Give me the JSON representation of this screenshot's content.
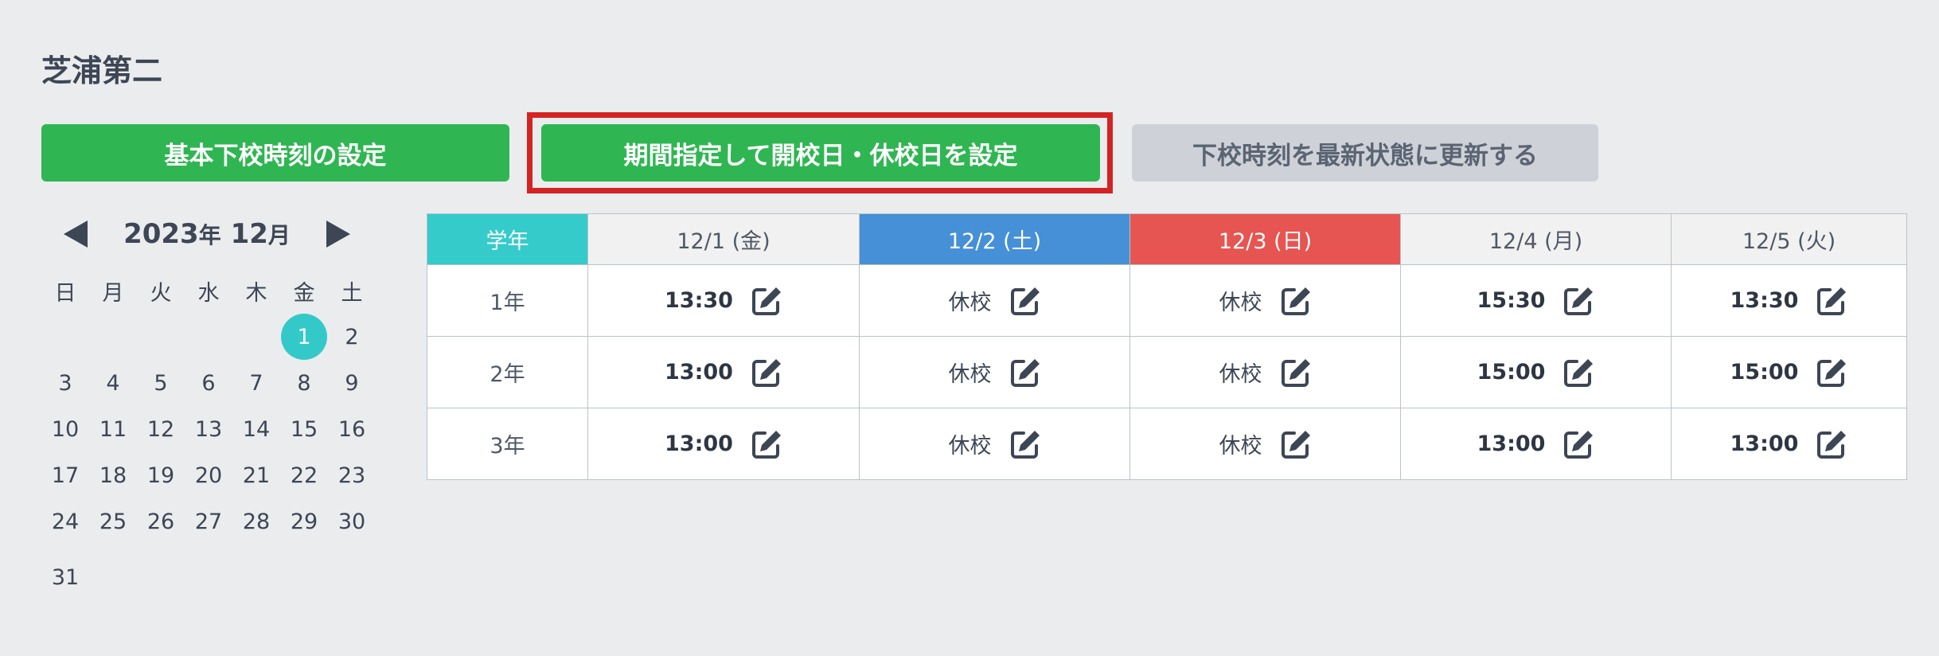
{
  "school_name": "芝浦第二",
  "buttons": {
    "basic": "基本下校時刻の設定",
    "period": "期間指定して開校日・休校日を設定",
    "refresh": "下校時刻を最新状態に更新する"
  },
  "colors": {
    "green": "#2fb652",
    "teal": "#36cbcb",
    "saturday": "#4590d6",
    "sunday": "#e65551",
    "highlight": "#d32423"
  },
  "calendar": {
    "year": "2023",
    "year_suffix": "年",
    "month": "12",
    "month_suffix": "月",
    "weekdays": [
      "日",
      "月",
      "火",
      "水",
      "木",
      "金",
      "土"
    ],
    "weeks": [
      [
        "",
        "",
        "",
        "",
        "",
        "1",
        "2"
      ],
      [
        "3",
        "4",
        "5",
        "6",
        "7",
        "8",
        "9"
      ],
      [
        "10",
        "11",
        "12",
        "13",
        "14",
        "15",
        "16"
      ],
      [
        "17",
        "18",
        "19",
        "20",
        "21",
        "22",
        "23"
      ],
      [
        "24",
        "25",
        "26",
        "27",
        "28",
        "29",
        "30"
      ],
      [
        "31",
        "",
        "",
        "",
        "",
        "",
        ""
      ]
    ],
    "selected_day": "1"
  },
  "schedule": {
    "grade_header": "学年",
    "columns": [
      {
        "label": "12/1 (金)",
        "type": "weekday"
      },
      {
        "label": "12/2 (土)",
        "type": "sat"
      },
      {
        "label": "12/3 (日)",
        "type": "sun"
      },
      {
        "label": "12/4 (月)",
        "type": "weekday"
      },
      {
        "label": "12/5 (火)",
        "type": "weekday"
      }
    ],
    "rows": [
      {
        "grade": "1年",
        "values": [
          "13:30",
          "休校",
          "休校",
          "15:30",
          "13:30"
        ]
      },
      {
        "grade": "2年",
        "values": [
          "13:00",
          "休校",
          "休校",
          "15:00",
          "15:00"
        ]
      },
      {
        "grade": "3年",
        "values": [
          "13:00",
          "休校",
          "休校",
          "13:00",
          "13:00"
        ]
      }
    ]
  }
}
